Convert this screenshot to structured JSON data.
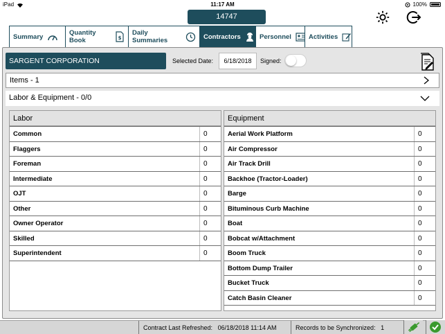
{
  "statusbar": {
    "device": "iPad",
    "time": "11:17 AM",
    "battery": "100%"
  },
  "contract_id": "14747",
  "tabs": [
    {
      "label": "Summary",
      "icon": "gauge-icon"
    },
    {
      "label": "Quantity Book",
      "icon": "document-dollar-icon"
    },
    {
      "label": "Daily Summaries",
      "icon": "clock-icon"
    },
    {
      "label": "Contractors",
      "icon": "worker-icon",
      "active": true
    },
    {
      "label": "Personnel",
      "icon": "id-card-icon"
    },
    {
      "label": "Activities",
      "icon": "edit-icon"
    }
  ],
  "contractor": {
    "name": "SARGENT CORPORATION",
    "selected_date_label": "Selected Date:",
    "selected_date": "6/18/2018",
    "signed_label": "Signed:",
    "signed": false
  },
  "items_section": {
    "label": "Items - 1"
  },
  "labor_equipment_section": {
    "label": "Labor & Equipment - 0/0"
  },
  "labor": {
    "header": "Labor",
    "rows": [
      {
        "name": "Common",
        "value": "0"
      },
      {
        "name": "Flaggers",
        "value": "0"
      },
      {
        "name": "Foreman",
        "value": "0"
      },
      {
        "name": "Intermediate",
        "value": "0"
      },
      {
        "name": "OJT",
        "value": "0"
      },
      {
        "name": "Other",
        "value": "0"
      },
      {
        "name": "Owner Operator",
        "value": "0"
      },
      {
        "name": "Skilled",
        "value": "0"
      },
      {
        "name": "Superintendent",
        "value": "0"
      }
    ]
  },
  "equipment": {
    "header": "Equipment",
    "rows": [
      {
        "name": "Aerial Work Platform",
        "value": "0"
      },
      {
        "name": "Air Compressor",
        "value": "0"
      },
      {
        "name": "Air Track Drill",
        "value": "0"
      },
      {
        "name": "Backhoe (Tractor-Loader)",
        "value": "0"
      },
      {
        "name": "Barge",
        "value": "0"
      },
      {
        "name": "Bituminous Curb Machine",
        "value": "0"
      },
      {
        "name": "Boat",
        "value": "0"
      },
      {
        "name": "Bobcat w/Attachment",
        "value": "0"
      },
      {
        "name": "Boom Truck",
        "value": "0"
      },
      {
        "name": "Bottom Dump Trailer",
        "value": "0"
      },
      {
        "name": "Bucket Truck",
        "value": "0"
      },
      {
        "name": "Catch Basin Cleaner",
        "value": "0"
      }
    ]
  },
  "footer": {
    "refreshed_label": "Contract Last Refreshed:",
    "refreshed_value": "06/18/2018 11:14 AM",
    "sync_label": "Records to be Synchronized:",
    "sync_count": "1"
  },
  "colors": {
    "brand": "#1e4d5c",
    "sync_green": "#3a9a2e"
  }
}
